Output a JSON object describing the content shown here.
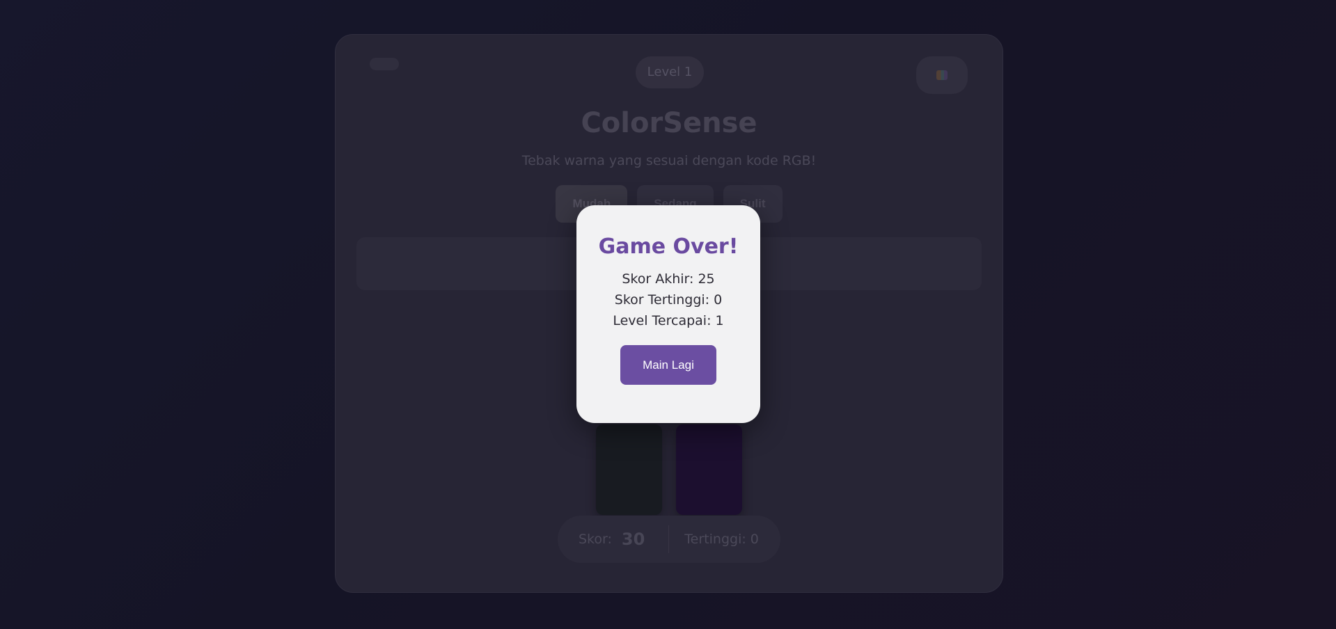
{
  "game": {
    "level_label": "Level 1",
    "title": "ColorSense",
    "subtitle": "Tebak warna yang sesuai dengan kode RGB!",
    "difficulties": [
      "Mudah",
      "Sedang",
      "Sulit"
    ],
    "active_difficulty": "Mudah",
    "sound_icon": "speaker-icon",
    "swatches": [
      {
        "color": "#1a1f22"
      },
      {
        "color": "#1f0f34"
      }
    ],
    "score_label": "Skor:",
    "score_value": "30",
    "high_score_text": "Tertinggi: 0"
  },
  "modal": {
    "title": "Game Over!",
    "final_score": "Skor Akhir: 25",
    "high_score": "Skor Tertinggi: 0",
    "level_reached": "Level Tercapai: 1",
    "play_again_label": "Main Lagi"
  },
  "colors": {
    "accent": "#6b4ea2",
    "modal_bg": "#f2f2f3"
  }
}
